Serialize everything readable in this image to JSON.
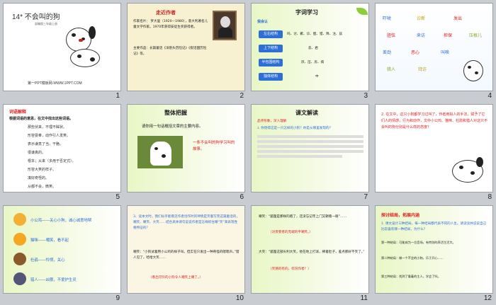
{
  "slides": [
    {
      "num": "1",
      "title": "14* 不会叫的狗",
      "subtitle": "部编版三年级上册",
      "footer": "第一PPT模板网-WWW.1PPT.COM"
    },
    {
      "num": "2",
      "title": "走近作者",
      "text1": "作家名片： 罗大里（1920—1980），意大利著名儿童文学作家。1970年获得安徒生奖获得者。",
      "text2": "主要作品：长篇童话《洋葱头历险记》《假话国历险记》等。"
    },
    {
      "num": "3",
      "title": "字词学习",
      "tag": "我会认",
      "rows": [
        {
          "label": "左右结构",
          "value": "吗、讨、歉、诊、胆、猎、降、注、兹"
        },
        {
          "label": "上下结构",
          "value": "恶、君"
        },
        {
          "label": "半包围结构",
          "value": "厌、压、房、病"
        },
        {
          "label": "独体结构",
          "value": "中"
        }
      ]
    },
    {
      "num": "4",
      "words": [
        "吓唬",
        "诊断",
        "发出",
        "胆怯",
        "来访",
        "担保",
        "压根儿",
        "差劲",
        "恶心",
        "叫唤",
        "猎人",
        "拜访"
      ]
    },
    {
      "num": "5",
      "title": "词语解释",
      "intro": "根据词语的意思，在文中找出这些词语。",
      "items": [
        "那些伏来，不理不睬状。",
        "形容耍奉，动作引人发笑。",
        "表示谦意了当，干脆。",
        "很谦真的。",
        "根本；从来（多用于否定式）。",
        "形容大笑的样子。",
        "凑好奇怪的。",
        "从都不会，微笑。"
      ]
    },
    {
      "num": "6",
      "title": "整体把握",
      "question": "请你用一句话概括文章的主要内容。",
      "answer": "一条不会叫的狗学习叫的故事。"
    },
    {
      "num": "7",
      "title": "课文解读",
      "sub": "品评形象，深入理解",
      "q": "1. 你觉得这是一只怎样的小狗？你是从哪里发现的？"
    },
    {
      "num": "8",
      "q": "2. 在文中，这只小狗都学习过叫了，作者用拟人的手法，赋予了它们人的情感，行为和动作，文中小公鸡、猫咪、杜鹃和猎人对这只不会叫的狗分别是什么样的态度？"
    },
    {
      "num": "9",
      "items": [
        "小公鸡——关心小狗，诚心诚意地帮",
        "猫咪——嘲笑，看不起",
        "杜鹃——怜悯，关心",
        "猎人——凶狠，不爱护生灵"
      ]
    },
    {
      "num": "10",
      "text1": "3、读本文时，我们似乎能看见作者创作时的神情是笑着写完这篇童话的，嘲笑、嘲笑、大笑……结合具体请句说说作者是怎样抓住嘲“笑”来表现性格特征的？",
      "text2": "嘲笑：“小狗试着用小公鸡的样子叫，但实在只发出一种奇怪的嗯嗯声。”猎人见了，哈哈大笑……",
      "text3": "（看出可怜的小狗令人嘲笑上嘲了。）"
    },
    {
      "num": "11",
      "t1": "嘲笑：“狐狸是那样的跑了，还没忘记牢上门又朝看一眼”……",
      "t2": "（对贵婴者的无端的平嘲笑。）",
      "t3": "大笑：“狐狸这部尖利大笑，他在地上打滚，捧着肚子，差点那好不笑了。”",
      "t4": "（笑猜的有的，何况作者？）"
    },
    {
      "num": "12",
      "title": "探讨结局，拓展内涵",
      "intro": "1. 课文设计三种结局，每一种结局都代表不同的人生。请读读并说说自己比较喜欢哪一种结局，为什么？",
      "items": [
        "第一种结局：可能成为一位音场，有特别的养活生活大。",
        "第二种结局：做一个不会的小狗，乐于开心……",
        "第三种结局：找到了看着的主人，学会了叫。"
      ]
    }
  ]
}
